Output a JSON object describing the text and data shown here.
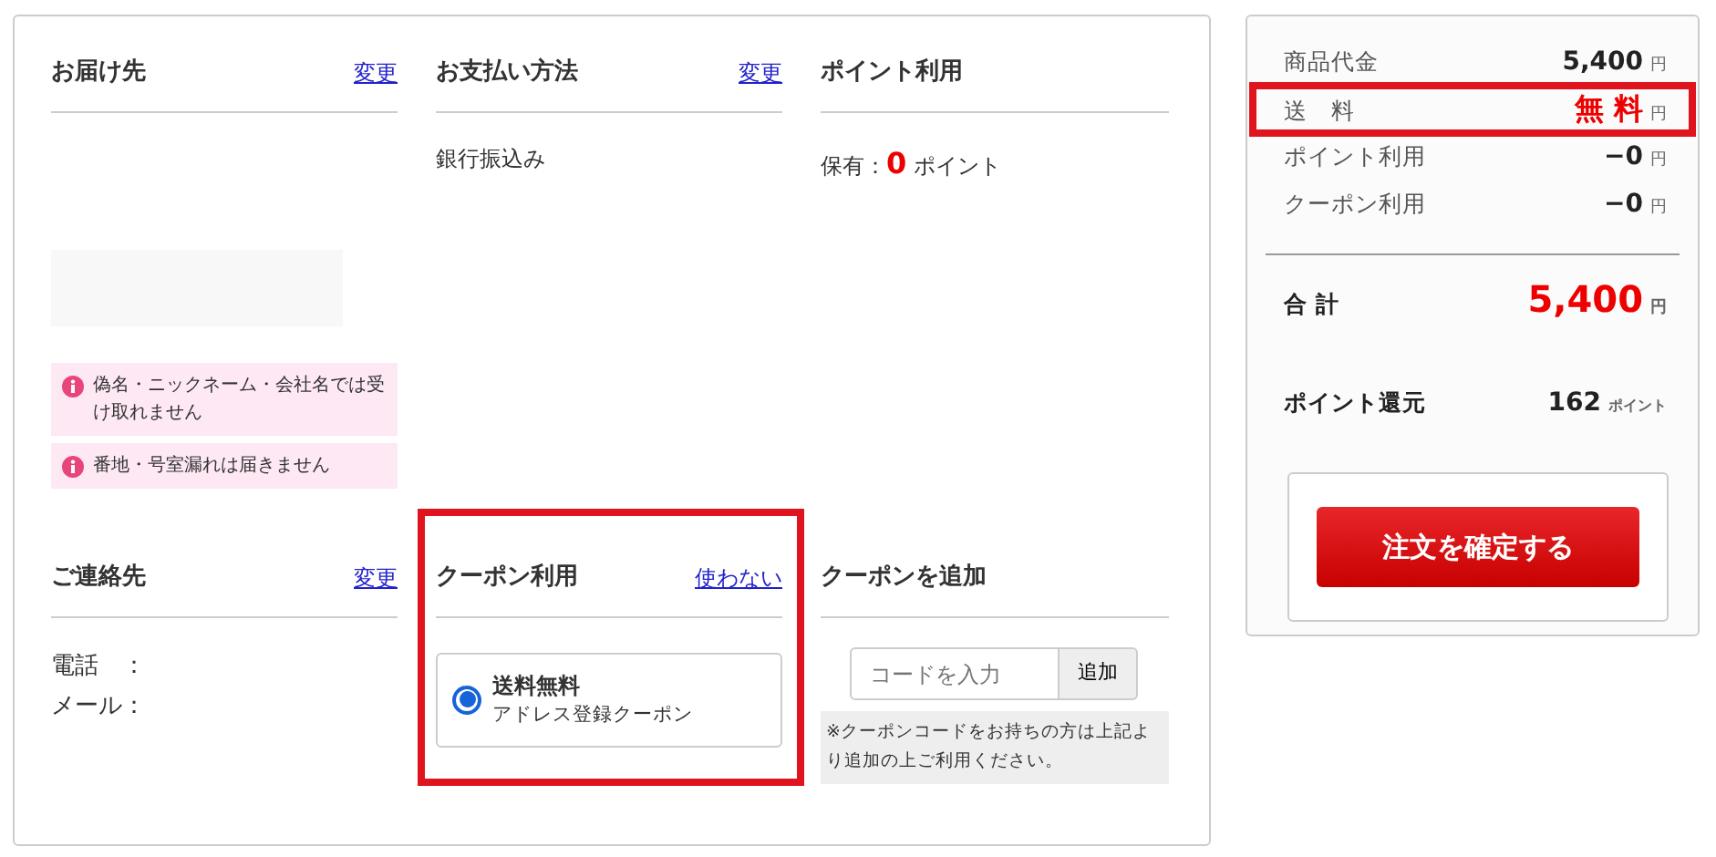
{
  "sections": [
    {
      "kind": "delivery",
      "title": "お届け先",
      "link": "変更",
      "redacted": true,
      "notices": [
        "偽名・ニックネーム・会社名では受け取れません",
        "番地・号室漏れは届きません"
      ]
    },
    {
      "kind": "payment",
      "title": "お支払い方法",
      "link": "変更",
      "text": "銀行振込み"
    },
    {
      "kind": "points",
      "title": "ポイント利用",
      "label": "保有：",
      "value": "0",
      "unit": "ポイント"
    },
    {
      "kind": "contact",
      "title": "ご連絡先",
      "link": "変更",
      "lines": [
        "電話　：",
        "メール："
      ]
    },
    {
      "kind": "coupon_use",
      "title": "クーポン利用",
      "link": "使わない",
      "highlighted": true,
      "options": [
        {
          "name": "送料無料",
          "description": "アドレス登録クーポン",
          "selected": true
        }
      ]
    },
    {
      "kind": "coupon_add",
      "title": "クーポンを追加",
      "placeholder": "コードを入力",
      "button": "追加",
      "note": "※クーポンコードをお持ちの方は上記より追加の上ご利用ください。"
    }
  ],
  "summary": {
    "rows": [
      {
        "kind": "normal",
        "label": "商品代金",
        "value": "5,400",
        "unit": "円",
        "highlighted": false
      },
      {
        "kind": "free",
        "label": "送　料",
        "value": "無 料",
        "unit": "円",
        "highlighted": true
      },
      {
        "kind": "normal",
        "label": "ポイント利用",
        "value": "−0",
        "unit": "円",
        "highlighted": false
      },
      {
        "kind": "normal",
        "label": "クーポン利用",
        "value": "−0",
        "unit": "円",
        "highlighted": false
      },
      {
        "kind": "total",
        "label": "合 計",
        "value": "5,400",
        "unit": "円",
        "highlighted": false
      },
      {
        "kind": "points",
        "label": "ポイント還元",
        "value": "162",
        "unit": "ポイント",
        "highlighted": false
      }
    ],
    "button": "注文を確定する"
  }
}
